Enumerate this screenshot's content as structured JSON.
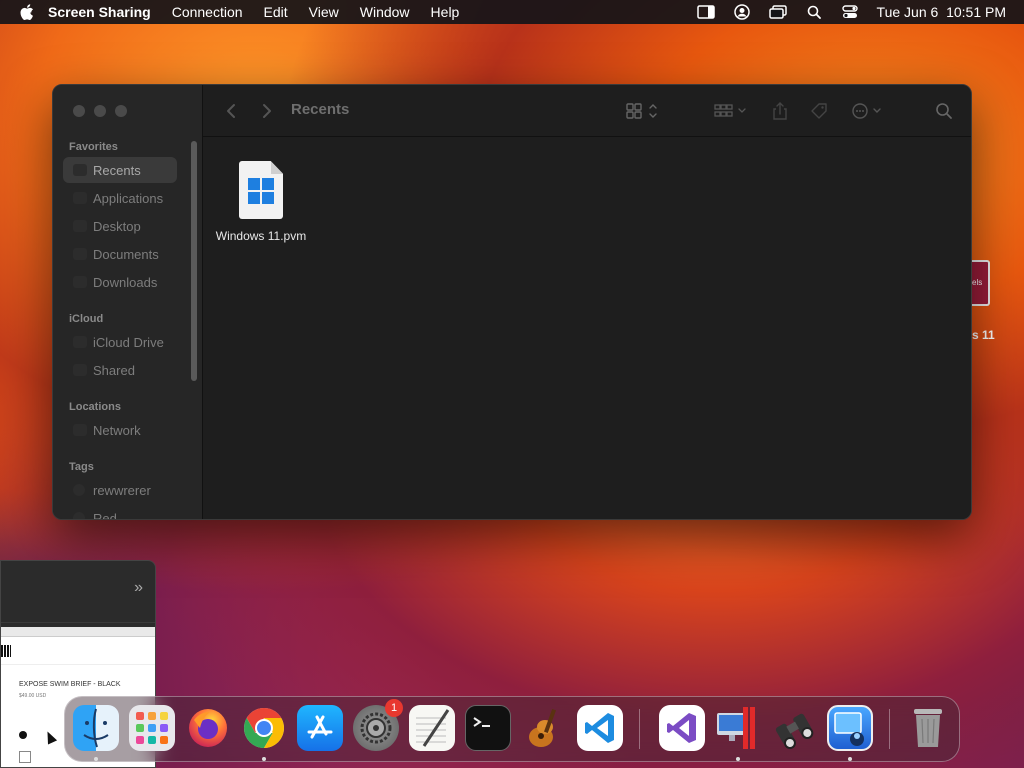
{
  "menubar": {
    "app_name": "Screen Sharing",
    "items": [
      "Connection",
      "Edit",
      "View",
      "Window",
      "Help"
    ],
    "clock": "Tue Jun 6  10:51 PM"
  },
  "finder": {
    "title": "Recents",
    "sidebar": {
      "favorites_header": "Favorites",
      "favorites": [
        "Recents",
        "Applications",
        "Desktop",
        "Documents",
        "Downloads"
      ],
      "icloud_header": "iCloud",
      "icloud": [
        "iCloud Drive",
        "Shared"
      ],
      "locations_header": "Locations",
      "locations": [
        "Network"
      ],
      "tags_header": "Tags",
      "tags": [
        "rewwrerer",
        "Red"
      ]
    },
    "files": [
      {
        "name": "Windows 11.pvm",
        "icon": "windows-file-icon"
      }
    ]
  },
  "desktop": {
    "partial_icon_text": "els",
    "partial_label": "s 11"
  },
  "thumbnail": {
    "title": "EXPOSE SWIM BRIEF - BLACK",
    "price": "$49.00 USD"
  },
  "dock": {
    "apps": [
      {
        "name": "Finder",
        "icon": "finder-icon",
        "running": true
      },
      {
        "name": "Launchpad",
        "icon": "launchpad-icon",
        "running": false
      },
      {
        "name": "Firefox",
        "icon": "firefox-icon",
        "running": false
      },
      {
        "name": "Chrome",
        "icon": "chrome-icon",
        "running": true
      },
      {
        "name": "App Store",
        "icon": "app-store-icon",
        "running": false
      },
      {
        "name": "System Settings",
        "icon": "system-settings-icon",
        "running": false,
        "badge": "1"
      },
      {
        "name": "TextEdit",
        "icon": "textedit-icon",
        "running": false
      },
      {
        "name": "Terminal",
        "icon": "terminal-icon",
        "running": false
      },
      {
        "name": "GarageBand",
        "icon": "garageband-icon",
        "running": false
      },
      {
        "name": "Visual Studio Code",
        "icon": "vscode-icon",
        "running": false
      },
      {
        "name": "Visual Studio",
        "icon": "visual-studio-icon",
        "running": false
      },
      {
        "name": "Parallels Desktop",
        "icon": "parallels-icon",
        "running": true
      },
      {
        "name": "Binoculars",
        "icon": "binoculars-icon",
        "running": false
      },
      {
        "name": "Screen Sharing",
        "icon": "screen-sharing-icon",
        "running": true
      },
      {
        "name": "Trash",
        "icon": "trash-icon",
        "running": false
      }
    ]
  }
}
